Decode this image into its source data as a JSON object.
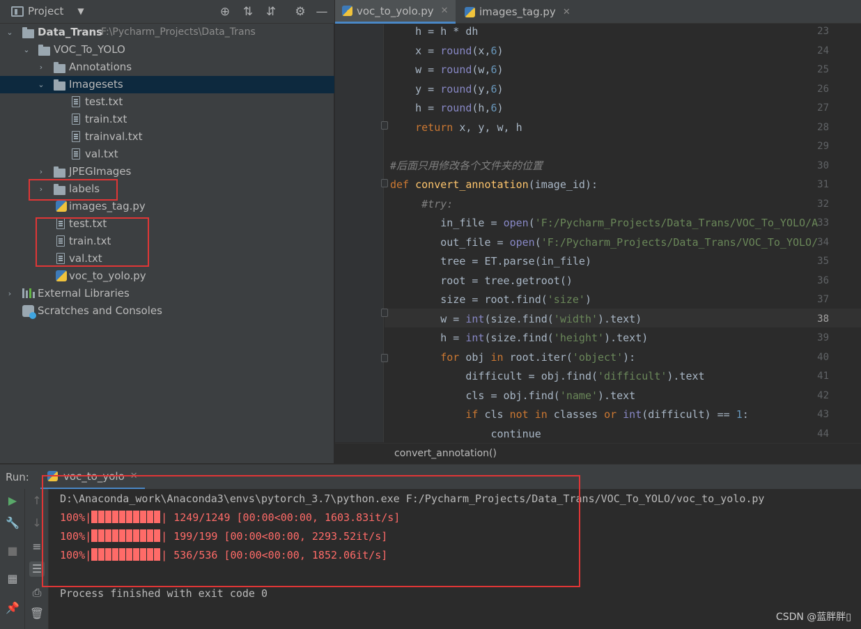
{
  "project_panel": {
    "title": "Project",
    "tree": [
      {
        "label": "Data_Trans",
        "path": "F:\\Pycharm_Projects\\Data_Trans",
        "type": "folder",
        "expanded": true
      },
      {
        "label": "VOC_To_YOLO",
        "type": "folder",
        "expanded": true
      },
      {
        "label": "Annotations",
        "type": "folder",
        "expanded": false
      },
      {
        "label": "Imagesets",
        "type": "folder",
        "expanded": true,
        "selected": true
      },
      {
        "label": "test.txt",
        "type": "file"
      },
      {
        "label": "train.txt",
        "type": "file"
      },
      {
        "label": "trainval.txt",
        "type": "file"
      },
      {
        "label": "val.txt",
        "type": "file"
      },
      {
        "label": "JPEGImages",
        "type": "folder",
        "expanded": false
      },
      {
        "label": "labels",
        "type": "folder",
        "expanded": false
      },
      {
        "label": "images_tag.py",
        "type": "python"
      },
      {
        "label": "test.txt",
        "type": "file"
      },
      {
        "label": "train.txt",
        "type": "file"
      },
      {
        "label": "val.txt",
        "type": "file"
      },
      {
        "label": "voc_to_yolo.py",
        "type": "python"
      },
      {
        "label": "External Libraries",
        "type": "library"
      },
      {
        "label": "Scratches and Consoles",
        "type": "scratch"
      }
    ]
  },
  "editor": {
    "tabs": [
      {
        "label": "voc_to_yolo.py",
        "active": true
      },
      {
        "label": "images_tag.py",
        "active": false
      }
    ],
    "current_line": 38,
    "line_numbers": [
      "23",
      "24",
      "25",
      "26",
      "27",
      "28",
      "29",
      "30",
      "31",
      "32",
      "33",
      "34",
      "35",
      "36",
      "37",
      "38",
      "39",
      "40",
      "41",
      "42",
      "43",
      "44"
    ],
    "lines": [
      "    h = h * dh",
      "    x = round(x,6)",
      "    w = round(w,6)",
      "    y = round(y,6)",
      "    h = round(h,6)",
      "    return x, y, w, h",
      "",
      "#后面只用修改各个文件夹的位置",
      "def convert_annotation(image_id):",
      "     #try:",
      "        in_file = open('F:/Pycharm_Projects/Data_Trans/VOC_To_YOLO/A",
      "        out_file = open('F:/Pycharm_Projects/Data_Trans/VOC_To_YOLO/",
      "        tree = ET.parse(in_file)",
      "        root = tree.getroot()",
      "        size = root.find('size')",
      "        w = int(size.find('width').text)",
      "        h = int(size.find('height').text)",
      "        for obj in root.iter('object'):",
      "            difficult = obj.find('difficult').text",
      "            cls = obj.find('name').text",
      "            if cls not in classes or int(difficult) == 1:",
      "                continue"
    ],
    "breadcrumb": "convert_annotation()"
  },
  "run_panel": {
    "label": "Run:",
    "tab": "voc_to_yolo",
    "output": {
      "command": "D:\\Anaconda_work\\Anaconda3\\envs\\pytorch_3.7\\python.exe F:/Pycharm_Projects/Data_Trans/VOC_To_YOLO/voc_to_yolo.py",
      "progress": [
        {
          "pct": "100%|",
          "stats": "| 1249/1249 [00:00<00:00, 1603.83it/s]",
          "fraction": 1.0
        },
        {
          "pct": "100%|",
          "stats": "| 199/199 [00:00<00:00, 2293.52it/s]",
          "fraction": 1.0
        },
        {
          "pct": "100%|",
          "stats": "| 536/536 [00:00<00:00, 1852.06it/s]",
          "fraction": 1.0
        }
      ],
      "finished": "Process finished with exit code 0"
    }
  },
  "watermark": "CSDN @蓝胖胖▯",
  "colors": {
    "background": "#2b2b2b",
    "panel": "#3c3f41",
    "selection": "#0d293e",
    "accent": "#4a88c7",
    "error_text": "#ff6b68",
    "highlight_box": "#e03636"
  }
}
